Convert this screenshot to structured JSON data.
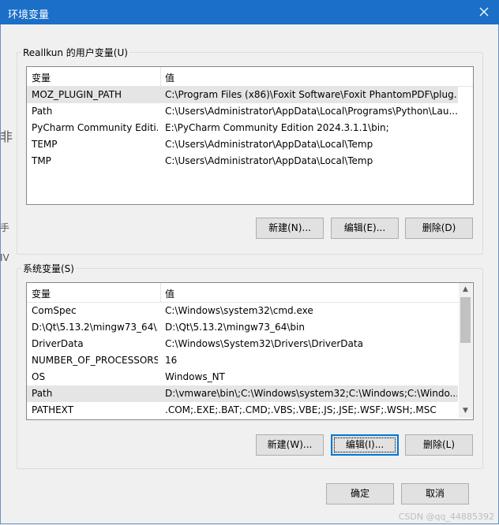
{
  "window": {
    "title": "环境变量"
  },
  "user_group": {
    "label": "Reallkun 的用户变量(U)",
    "columns": [
      "变量",
      "值"
    ],
    "rows": [
      {
        "name": "MOZ_PLUGIN_PATH",
        "value": "C:\\Program Files (x86)\\Foxit Software\\Foxit PhantomPDF\\plug..."
      },
      {
        "name": "Path",
        "value": "C:\\Users\\Administrator\\AppData\\Local\\Programs\\Python\\Lau..."
      },
      {
        "name": "PyCharm Community Editi...",
        "value": "E:\\PyCharm Community Edition 2024.3.1.1\\bin;"
      },
      {
        "name": "TEMP",
        "value": "C:\\Users\\Administrator\\AppData\\Local\\Temp"
      },
      {
        "name": "TMP",
        "value": "C:\\Users\\Administrator\\AppData\\Local\\Temp"
      }
    ],
    "buttons": {
      "new": "新建(N)...",
      "edit": "编辑(E)...",
      "delete": "删除(D)"
    }
  },
  "system_group": {
    "label": "系统变量(S)",
    "columns": [
      "变量",
      "值"
    ],
    "rows": [
      {
        "name": "ComSpec",
        "value": "C:\\Windows\\system32\\cmd.exe"
      },
      {
        "name": "D:\\Qt\\5.13.2\\mingw73_64\\...",
        "value": "D:\\Qt\\5.13.2\\mingw73_64\\bin"
      },
      {
        "name": "DriverData",
        "value": "C:\\Windows\\System32\\Drivers\\DriverData"
      },
      {
        "name": "NUMBER_OF_PROCESSORS",
        "value": "16"
      },
      {
        "name": "OS",
        "value": "Windows_NT"
      },
      {
        "name": "Path",
        "value": "D:\\vmware\\bin\\;C:\\Windows\\system32;C:\\Windows;C:\\Windo..."
      },
      {
        "name": "PATHEXT",
        "value": ".COM;.EXE;.BAT;.CMD;.VBS;.VBE;.JS;.JSE;.WSF;.WSH;.MSC"
      }
    ],
    "buttons": {
      "new": "新建(W)...",
      "edit": "编辑(I)...",
      "delete": "删除(L)"
    }
  },
  "footer": {
    "ok": "确定",
    "cancel": "取消"
  },
  "watermark": "CSDN @qq_44885392",
  "background_fragments": [
    "非",
    "手",
    "IV"
  ],
  "colors": {
    "titlebar": "#1b6fc7",
    "selection": "#e5e5e5",
    "default_button_border": "#0078d7"
  }
}
